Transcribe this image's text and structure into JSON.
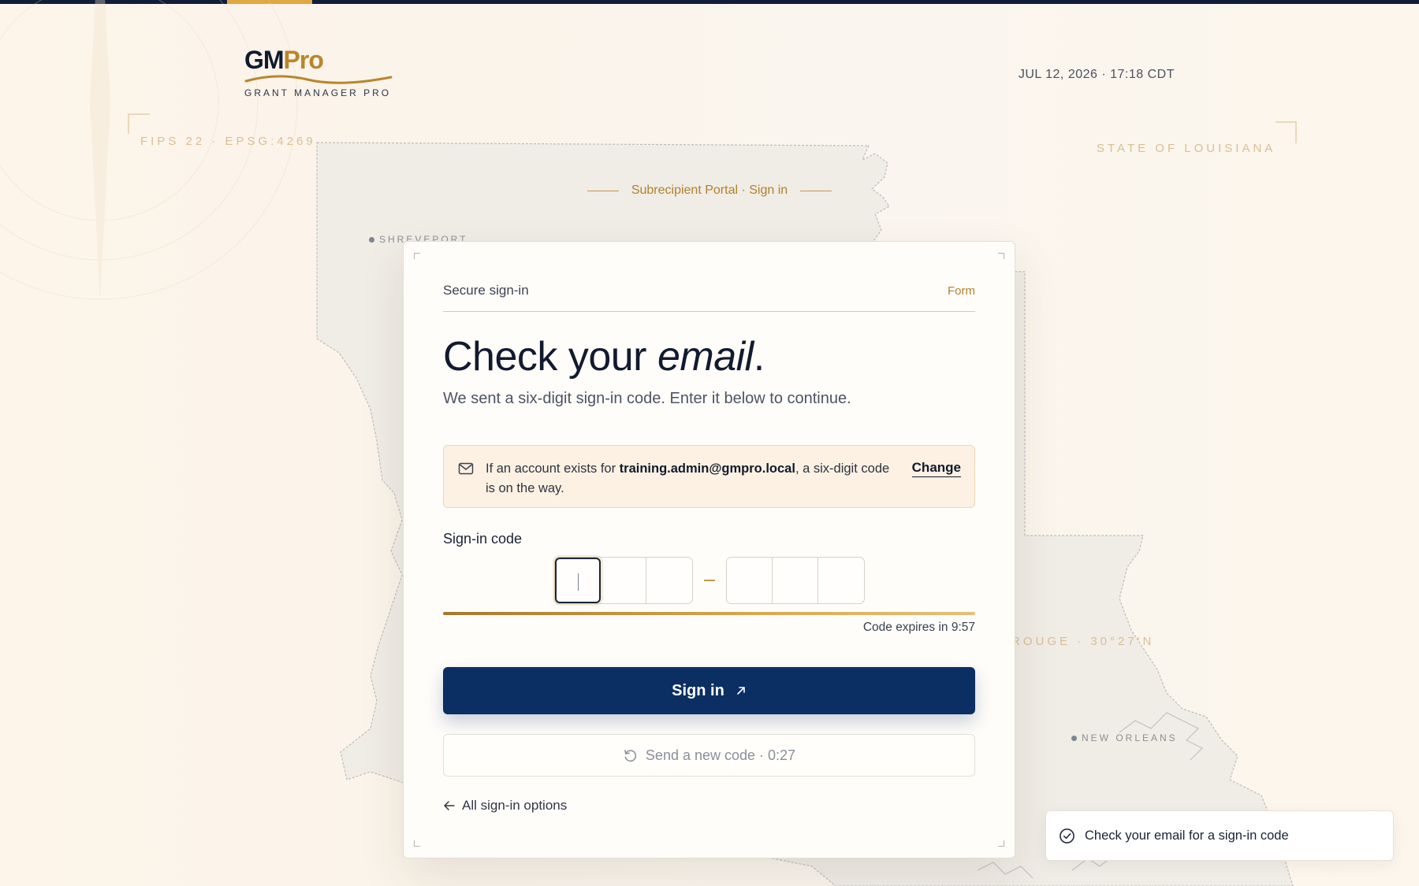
{
  "brand": {
    "logo_gm": "GM",
    "logo_pro": "Pro",
    "tagline": "GRANT MANAGER PRO",
    "accent_color": "#b8862b",
    "primary_color": "#0b2f63"
  },
  "header": {
    "datetime": "JUL 12, 2026 · 17:18 CDT"
  },
  "map": {
    "coord_left": "FIPS 22 · EPSG:4269",
    "coord_right": "STATE OF LOUISIANA",
    "coord_baton_rouge": "ROUGE · 30°27′N",
    "city_shreveport": "SHREVEPORT",
    "city_new_orleans": "NEW ORLEANS"
  },
  "portal_tag": "Subrecipient Portal · Sign in",
  "card": {
    "eyebrow": "Secure sign-in",
    "eyebrow_right": "Form",
    "title_plain": "Check your ",
    "title_emph": "email",
    "title_end": ".",
    "subtitle": "We sent a six-digit sign-in code. Enter it below to continue.",
    "notice": {
      "icon": "mail-icon",
      "text_before": "If an account exists for ",
      "email": "training.admin@gmpro.local",
      "text_after": ", a six-digit code is on the way.",
      "change_label": "Change"
    },
    "code": {
      "label": "Sign-in code",
      "digits": [
        "",
        "",
        "",
        "",
        "",
        ""
      ],
      "active_index": 0,
      "expires": "Code expires in 9:57",
      "remaining_fraction": 1.0
    },
    "signin_label": "Sign in",
    "resend_label": "Send a new code · 0:27",
    "back_label": "All sign-in options"
  },
  "toast": {
    "icon": "check-circle-icon",
    "text": "Check your email for a sign-in code"
  }
}
